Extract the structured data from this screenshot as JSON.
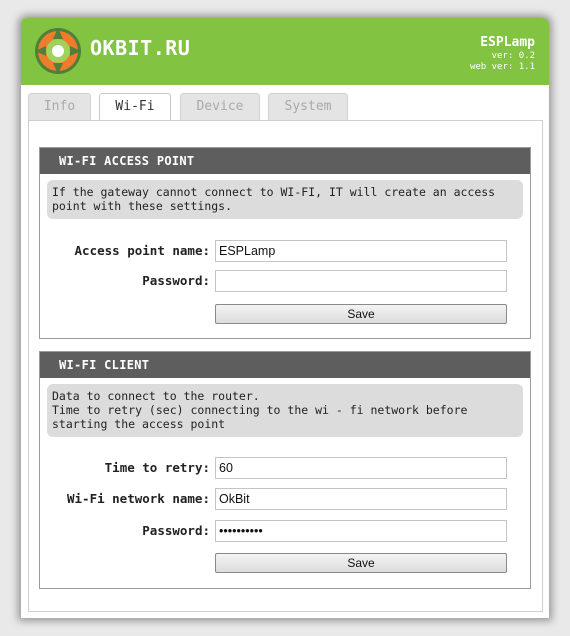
{
  "header": {
    "brand": "OKBIT.RU",
    "device_name": "ESPLamp",
    "version": "ver: 0.2",
    "web_version": "web ver: 1.1",
    "bg_color": "#82c341"
  },
  "tabs": [
    {
      "label": "Info",
      "active": false
    },
    {
      "label": "Wi-Fi",
      "active": true
    },
    {
      "label": "Device",
      "active": false
    },
    {
      "label": "System",
      "active": false
    }
  ],
  "access_point": {
    "title": "WI-FI ACCESS POINT",
    "note_line1": "If the gateway cannot connect to WI-FI, IT will create an access",
    "note_line2": "point with these settings.",
    "name_label": "Access point name:",
    "name_value": "ESPLamp",
    "password_label": "Password:",
    "password_value": "",
    "save_label": "Save"
  },
  "client": {
    "title": "WI-FI CLIENT",
    "note_line1": "Data to connect to the router.",
    "note_line2": "Time to retry (sec) connecting to the wi - fi network before",
    "note_line3": "starting the access point",
    "retry_label": "Time to retry:",
    "retry_value": "60",
    "network_label": "Wi-Fi network name:",
    "network_value": "OkBit",
    "password_label": "Password:",
    "password_value": "1234567890",
    "save_label": "Save"
  }
}
